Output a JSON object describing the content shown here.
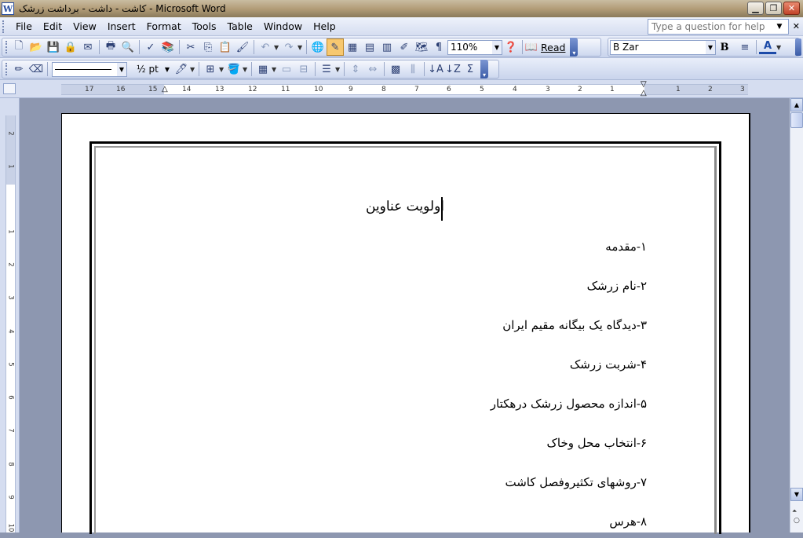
{
  "window": {
    "title": "کاشت - داشت - برداشت زرشک  - Microsoft Word",
    "app_icon_letter": "W"
  },
  "menu": {
    "items": [
      "File",
      "Edit",
      "View",
      "Insert",
      "Format",
      "Tools",
      "Table",
      "Window",
      "Help"
    ],
    "help_placeholder": "Type a question for help"
  },
  "toolbar_standard": {
    "zoom": "110%",
    "read_label": "Read"
  },
  "toolbar_formatting": {
    "font_name": "B Zar",
    "bold_label": "B"
  },
  "toolbar_tables": {
    "line_weight": "½ pt"
  },
  "ruler": {
    "ticks": [
      "17",
      "16",
      "15",
      "14",
      "13",
      "12",
      "11",
      "10",
      "9",
      "8",
      "7",
      "6",
      "5",
      "4",
      "3",
      "2",
      "1",
      "1",
      "2",
      "3"
    ],
    "vticks": [
      "2",
      "1",
      "1",
      "2",
      "3",
      "4",
      "5",
      "6",
      "7",
      "8",
      "9",
      "10"
    ]
  },
  "document": {
    "title": "اولویت عناوین",
    "lines": [
      "۱-مقدمه",
      "۲-نام زرشک",
      "۳-دیدگاه یک بیگانه مقیم ایران",
      "۴-شربت زرشک",
      "۵-اندازه محصول زرشک درهکتار",
      "۶-انتخاب محل وخاک",
      "۷-روشهای تکثیروفصل کاشت",
      "۸-هرس"
    ]
  }
}
